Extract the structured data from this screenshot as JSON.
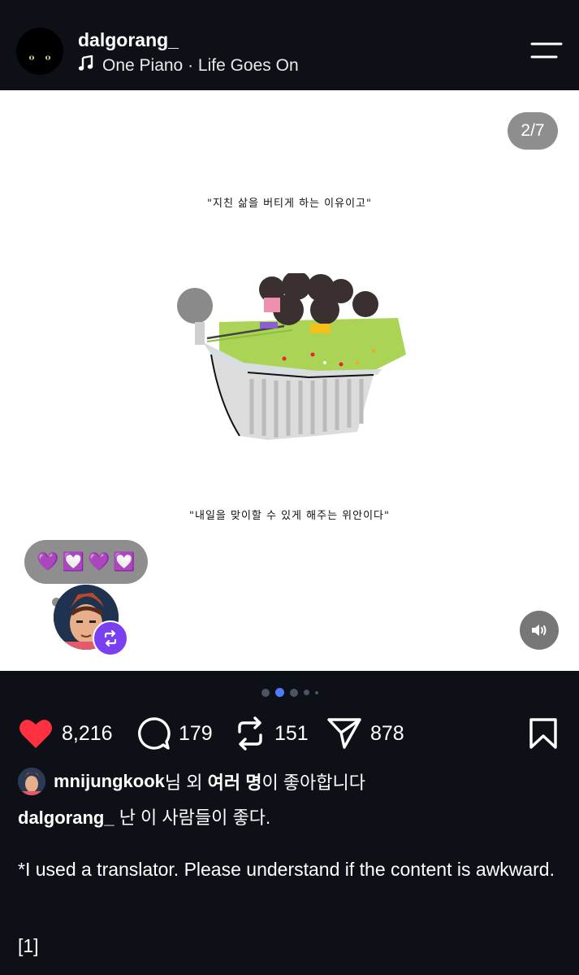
{
  "header": {
    "username": "dalgorang_",
    "song": "One Piano · Life Goes On"
  },
  "post": {
    "counter": "2/7",
    "caption_top": "\"지친 삶을 버티게 하는 이유이고\"",
    "caption_bottom": "\"내일을 맞이할 수 있게 해주는 위안이다\"",
    "reaction_emojis": [
      "💜",
      "💟",
      "💜",
      "💟"
    ]
  },
  "actions": {
    "likes": "8,216",
    "comments": "179",
    "reposts": "151",
    "shares": "878"
  },
  "liked_by": {
    "user": "mnijungkook",
    "suffix1": "님 외 ",
    "others": "여러 명",
    "suffix2": "이 좋아합니다"
  },
  "caption": {
    "user": "dalgorang_",
    "text": " 난 이 사람들이 좋다.",
    "body": "*I used a translator. Please understand if the content is awkward.",
    "footnote": "[1]"
  },
  "colors": {
    "background": "#0d1117",
    "like": "#ff3040",
    "active_dot": "#4f7cff",
    "repost_badge": "#7b3ff2"
  }
}
